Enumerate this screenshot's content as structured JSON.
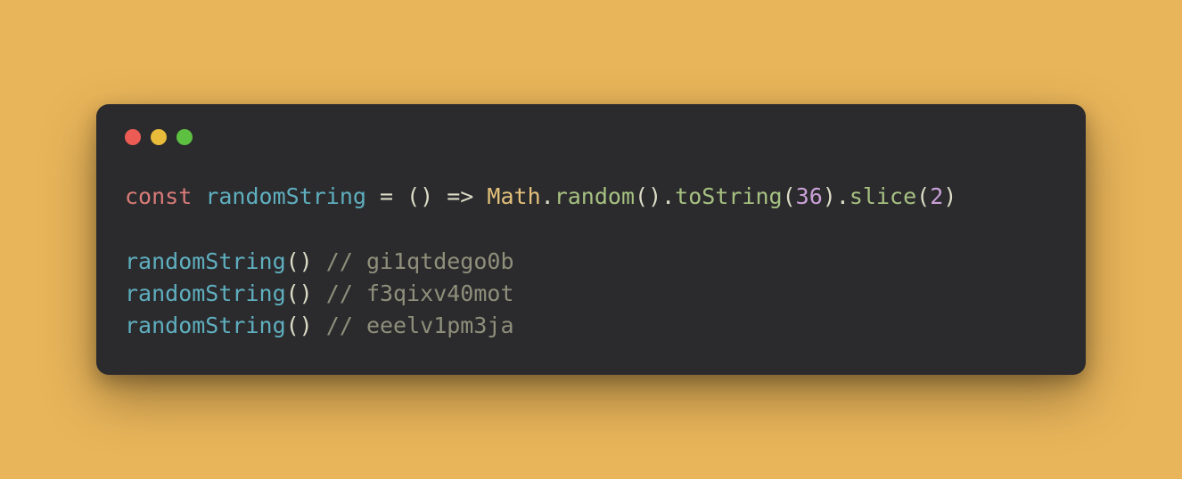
{
  "colors": {
    "background": "#e9b55a",
    "window": "#2b2b2e",
    "trafficRed": "#ec5c54",
    "trafficYellow": "#e9bb3a",
    "trafficGreen": "#5dc041"
  },
  "code": {
    "line1": {
      "keyword": "const",
      "name": "randomString",
      "assign": " = () => ",
      "class": "Math",
      "dot1": ".",
      "method1": "random",
      "paren1": "().",
      "method2": "toString",
      "open2": "(",
      "arg1": "36",
      "close2": ").",
      "method3": "slice",
      "open3": "(",
      "arg2": "2",
      "close3": ")"
    },
    "line3": {
      "call": "randomString",
      "paren": "()",
      "comment": " // gi1qtdego0b"
    },
    "line4": {
      "call": "randomString",
      "paren": "()",
      "comment": " // f3qixv40mot"
    },
    "line5": {
      "call": "randomString",
      "paren": "()",
      "comment": " // eeelv1pm3ja"
    }
  }
}
